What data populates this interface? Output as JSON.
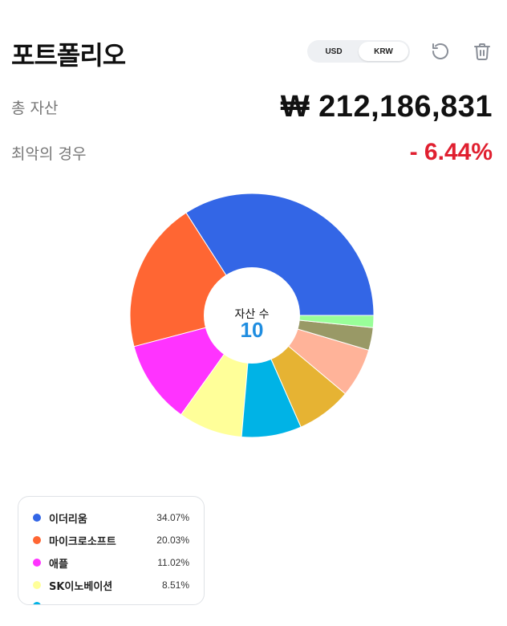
{
  "header": {
    "title": "포트폴리오",
    "currency_options": [
      "USD",
      "KRW"
    ],
    "currency_selected": "KRW"
  },
  "summary": {
    "total_label": "총 자산",
    "total_value": "₩ 212,186,831",
    "worst_label": "최악의 경우",
    "worst_value": "- 6.44%"
  },
  "icons": {
    "refresh": "refresh-icon",
    "trash": "trash-icon"
  },
  "colors": {
    "accent_blue": "#1f8de0",
    "negative_red": "#e02030"
  },
  "chart_data": {
    "type": "pie",
    "center_label": "자산 수",
    "center_value": "10",
    "slices": [
      {
        "label": "이더리움",
        "value": 34.07,
        "color": "#3366e6"
      },
      {
        "label": "마이크로소프트",
        "value": 20.03,
        "color": "#ff6633"
      },
      {
        "label": "애플",
        "value": 11.02,
        "color": "#ff33ff"
      },
      {
        "label": "SK이노베이션",
        "value": 8.51,
        "color": "#ffff99"
      },
      {
        "value": 7.95,
        "color": "#00b3e6"
      },
      {
        "value": 7.3,
        "color": "#e6b333"
      },
      {
        "value": 6.5,
        "color": "#ffb399"
      },
      {
        "value": 3.0,
        "color": "#999966"
      },
      {
        "value": 1.6,
        "color": "#99ff99"
      }
    ]
  },
  "legend": {
    "items": [
      {
        "label": "이더리움",
        "pct": "34.07%",
        "color": "#3366e6"
      },
      {
        "label": "마이크로소프트",
        "pct": "20.03%",
        "color": "#ff6633"
      },
      {
        "label": "애플",
        "pct": "11.02%",
        "color": "#ff33ff"
      },
      {
        "label": "SK이노베이션",
        "pct": "8.51%",
        "color": "#ffff99"
      }
    ],
    "partial_item": {
      "color": "#00b3e6"
    }
  }
}
